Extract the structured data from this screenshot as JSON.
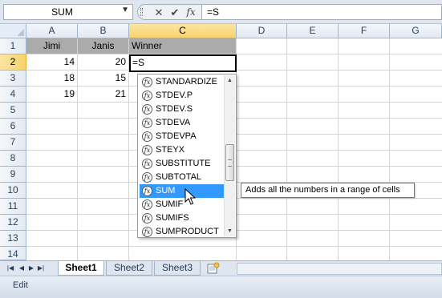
{
  "formula_bar": {
    "name_box": "SUM",
    "name_box_arrow": "▼",
    "cancel_glyph": "✕",
    "enter_glyph": "✔",
    "fx_label": "fx",
    "formula": "=S"
  },
  "columns": [
    "A",
    "B",
    "C",
    "D",
    "E",
    "F",
    "G"
  ],
  "rows": [
    "1",
    "2",
    "3",
    "4",
    "5",
    "6",
    "7",
    "8",
    "9",
    "10",
    "11",
    "12",
    "13",
    "14"
  ],
  "active": {
    "column": "C",
    "row": "2"
  },
  "cells": {
    "header": [
      "Jimi",
      "Janis",
      "Winner"
    ],
    "data": [
      [
        "14",
        "20"
      ],
      [
        "18",
        "15"
      ],
      [
        "19",
        "21"
      ]
    ],
    "active_cell_value": "=S"
  },
  "autocomplete": {
    "items": [
      "STANDARDIZE",
      "STDEV.P",
      "STDEV.S",
      "STDEVA",
      "STDEVPA",
      "STEYX",
      "SUBSTITUTE",
      "SUBTOTAL",
      "SUM",
      "SUMIF",
      "SUMIFS",
      "SUMPRODUCT"
    ],
    "selected": "SUM",
    "icon": "function-fx-icon",
    "selected_color": "#3399ff"
  },
  "tooltip": "Adds all the numbers in a range of cells",
  "sheet_tabs": [
    "Sheet1",
    "Sheet2",
    "Sheet3"
  ],
  "active_sheet": "Sheet1",
  "status": {
    "mode": "Edit"
  },
  "colors": {
    "header_bg": "#e4ecf7",
    "active_header": "#f8d26c",
    "table_header_fill": "#ababab"
  }
}
